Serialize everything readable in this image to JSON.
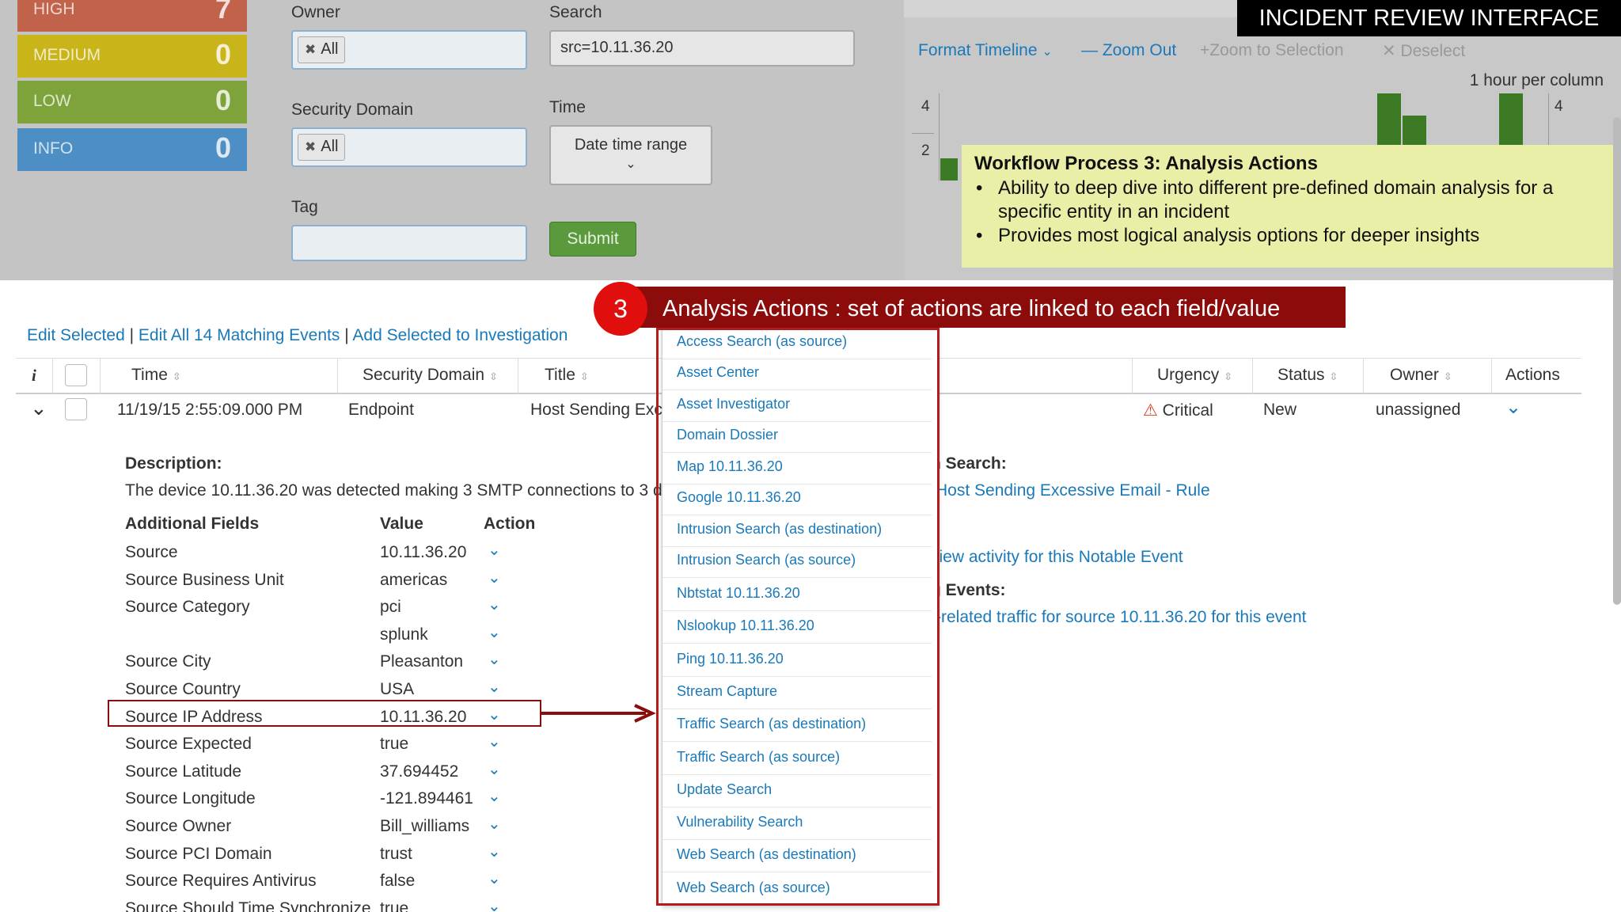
{
  "banner": {
    "title": "INCIDENT REVIEW INTERFACE"
  },
  "severity": [
    {
      "label": "HIGH",
      "count": "7",
      "color": "#c1624a"
    },
    {
      "label": "MEDIUM",
      "count": "0",
      "color": "#c9b41a"
    },
    {
      "label": "LOW",
      "count": "0",
      "color": "#7fa33b"
    },
    {
      "label": "INFO",
      "count": "0",
      "color": "#4d8fc4"
    }
  ],
  "filters": {
    "owner_label": "Owner",
    "owner_token": "All",
    "search_label": "Search",
    "search_value": "src=10.11.36.20",
    "security_domain_label": "Security Domain",
    "security_domain_token": "All",
    "time_label": "Time",
    "time_value": "Date time range",
    "tag_label": "Tag",
    "submit_label": "Submit"
  },
  "timeline": {
    "format_label": "Format Timeline",
    "zoom_out": "Zoom Out",
    "zoom_selection": "Zoom to Selection",
    "deselect": "Deselect",
    "scale": "1 hour per column",
    "y_left": [
      "4",
      "2"
    ],
    "y_right": "4"
  },
  "callout": {
    "title": "Workflow Process 3: Analysis Actions",
    "bullets": [
      "Ability to deep dive into different pre-defined domain analysis for a specific entity in an incident",
      "Provides most logical analysis options for deeper insights"
    ]
  },
  "annotation": {
    "step": "3",
    "text": "Analysis Actions : set of actions are linked to each field/value"
  },
  "table_actions": {
    "edit_selected": "Edit Selected",
    "edit_all": "Edit All 14 Matching Events",
    "add_investigation": "Add Selected to Investigation",
    "sep": "|"
  },
  "columns": {
    "info": "i",
    "time": "Time",
    "domain": "Security Domain",
    "title": "Title",
    "urgency": "Urgency",
    "status": "Status",
    "owner": "Owner",
    "actions": "Actions"
  },
  "row": {
    "time": "11/19/15 2:55:09.000 PM",
    "domain": "Endpoint",
    "title": "Host Sending Exce",
    "urgency": "Critical",
    "status": "New",
    "owner": "unassigned"
  },
  "details": {
    "description_label": "Description:",
    "description_text": "The device 10.11.36.20 was detected making 3 SMTP connections to 3 de",
    "af_header": "Additional Fields",
    "value_header": "Value",
    "action_header": "Action",
    "fields": [
      {
        "k": "Source",
        "v": "10.11.36.20"
      },
      {
        "k": "Source Business Unit",
        "v": "americas"
      },
      {
        "k": "Source Category",
        "v": "pci"
      },
      {
        "k": "",
        "v": "splunk"
      },
      {
        "k": "Source City",
        "v": "Pleasanton"
      },
      {
        "k": "Source Country",
        "v": "USA"
      },
      {
        "k": "Source IP Address",
        "v": "10.11.36.20"
      },
      {
        "k": "Source Expected",
        "v": "true"
      },
      {
        "k": "Source Latitude",
        "v": "37.694452"
      },
      {
        "k": "Source Longitude",
        "v": "-121.894461"
      },
      {
        "k": "Source Owner",
        "v": "Bill_williams"
      },
      {
        "k": "Source PCI Domain",
        "v": "trust"
      },
      {
        "k": "Source Requires Antivirus",
        "v": "false"
      },
      {
        "k": "Source Should Time Synchronize",
        "v": "true"
      }
    ]
  },
  "right_details": {
    "search_label": "n Search:",
    "search_link": "Host Sending Excessive Email - Rule",
    "activity_link": "view activity for this Notable Event",
    "events_label": "g Events:",
    "events_link": "-related traffic for source 10.11.36.20 for this event"
  },
  "dropdown": [
    "Access Search (as source)",
    "Asset Center",
    "Asset Investigator",
    "Domain Dossier",
    "Map 10.11.36.20",
    "Google 10.11.36.20",
    "Intrusion Search (as destination)",
    "Intrusion Search (as source)",
    "Nbtstat 10.11.36.20",
    "Nslookup 10.11.36.20",
    "Ping 10.11.36.20",
    "Stream Capture",
    "Traffic Search (as destination)",
    "Traffic Search (as source)",
    "Update Search",
    "Vulnerability Search",
    "Web Search (as destination)",
    "Web Search (as source)"
  ]
}
